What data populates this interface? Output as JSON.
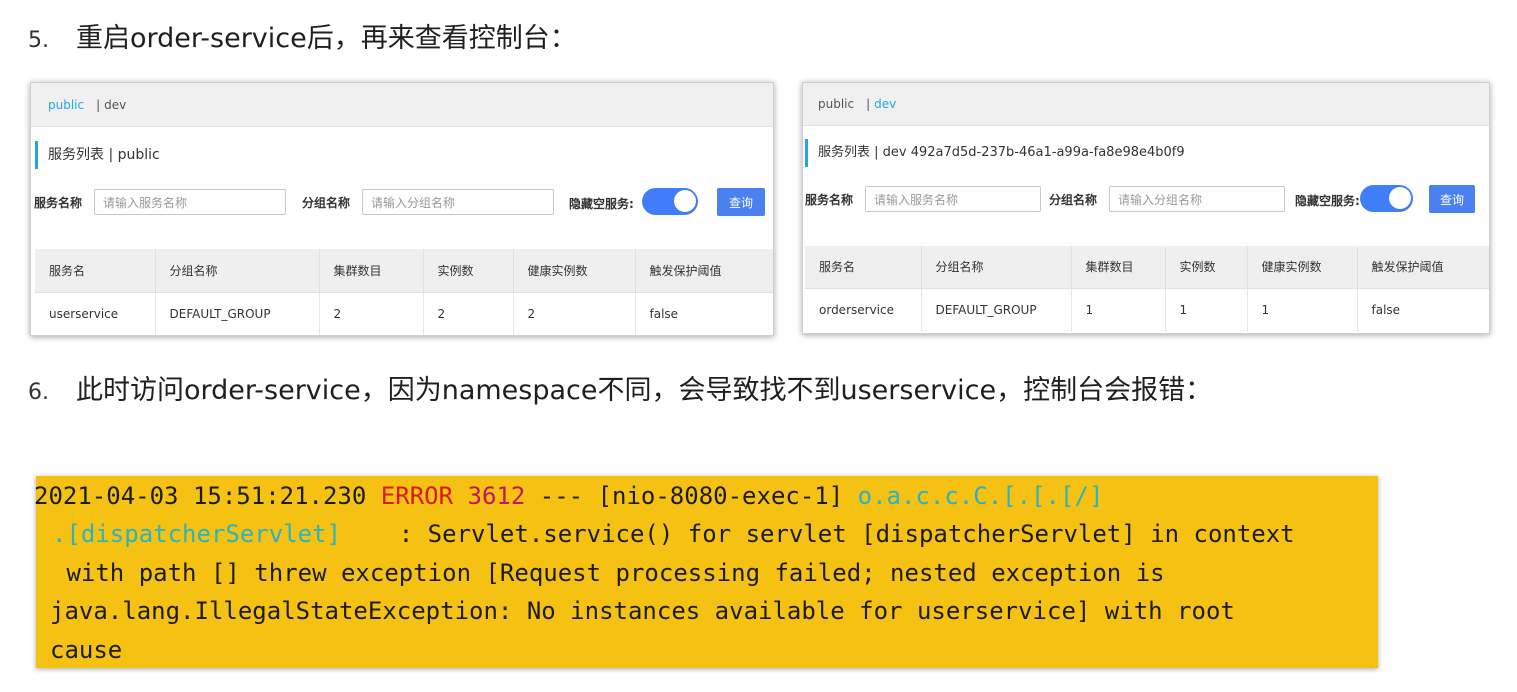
{
  "steps": [
    {
      "num": "5.",
      "text": "重启order-service后，再来查看控制台："
    },
    {
      "num": "6.",
      "text": "此时访问order-service，因为namespace不同，会导致找不到userservice，控制台会报错："
    }
  ],
  "panel_left": {
    "namespaces": [
      "public",
      "dev"
    ],
    "active_namespace": "public",
    "separator": "|",
    "list_title": "服务列表 | public",
    "service_name_label": "服务名称",
    "service_name_placeholder": "请输入服务名称",
    "group_name_label": "分组名称",
    "group_name_placeholder": "请输入分组名称",
    "hide_empty_label": "隐藏空服务:",
    "hide_empty_on": true,
    "query_button": "查询",
    "columns": [
      "服务名",
      "分组名称",
      "集群数目",
      "实例数",
      "健康实例数",
      "触发保护阈值"
    ],
    "rows": [
      [
        "userservice",
        "DEFAULT_GROUP",
        "2",
        "2",
        "2",
        "false"
      ]
    ]
  },
  "panel_right": {
    "namespaces": [
      "public",
      "dev"
    ],
    "active_namespace": "dev",
    "separator": "|",
    "list_title": "服务列表 | dev 492a7d5d-237b-46a1-a99a-fa8e98e4b0f9",
    "service_name_label": "服务名称",
    "service_name_placeholder": "请输入服务名称",
    "group_name_label": "分组名称",
    "group_name_placeholder": "请输入分组名称",
    "hide_empty_label": "隐藏空服务:",
    "hide_empty_on": true,
    "query_button": "查询",
    "columns": [
      "服务名",
      "分组名称",
      "集群数目",
      "实例数",
      "健康实例数",
      "触发保护阈值"
    ],
    "rows": [
      [
        "orderservice",
        "DEFAULT_GROUP",
        "1",
        "1",
        "1",
        "false"
      ]
    ]
  },
  "console": {
    "timestamp": "2021-04-03 15:51:21.230",
    "level": "ERROR",
    "pid": "3612",
    "dashes": "---",
    "thread": "[nio-8080-exec-1]",
    "logger_1": "o.a.c.c.C.[.[.[/]",
    "logger_2": ".[dispatcherServlet]",
    "msg_1": "    : Servlet.service() for servlet [dispatcherServlet] in context",
    "msg_2": " with path [] threw exception [Request processing failed; nested exception is",
    "msg_3": "java.lang.IllegalStateException: No instances available for userservice] with root",
    "msg_4": "cause"
  },
  "colors": {
    "console_bg": "#f5c214",
    "error": "#d61a1a",
    "pid": "#c2185b",
    "logger": "#2bb3bf",
    "accent": "#23a7e0",
    "toggle": "#3f7ef7",
    "button": "#4a80f0"
  }
}
